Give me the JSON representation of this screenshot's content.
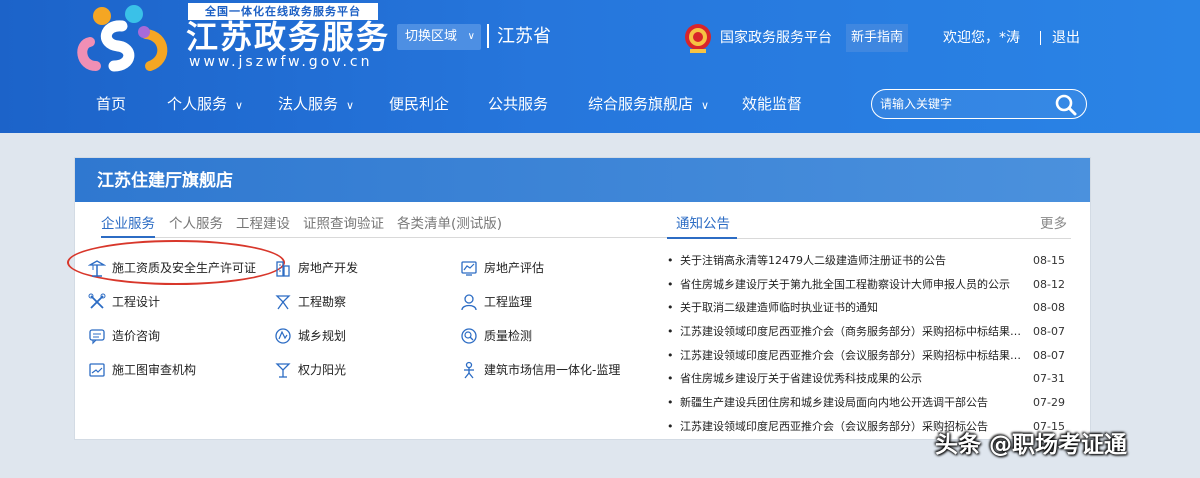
{
  "header": {
    "brand_tag": "全国一体化在线政务服务平台",
    "brand_title": "江苏政务服务",
    "brand_url": "www.jszwfw.gov.cn",
    "switch_region": "切换区域",
    "region_name": "江苏省",
    "gov_platform": "国家政务服务平台",
    "guide": "新手指南",
    "welcome": "欢迎您，*涛",
    "logout": "退出"
  },
  "nav": {
    "items": [
      "首页",
      "个人服务",
      "法人服务",
      "便民利企",
      "公共服务",
      "综合服务旗舰店",
      "效能监督"
    ]
  },
  "search": {
    "placeholder": "请输入关键字"
  },
  "panel": {
    "title": "江苏住建厅旗舰店",
    "tabs": [
      "企业服务",
      "个人服务",
      "工程建设",
      "证照查询验证",
      "各类清单(测试版)"
    ],
    "services": [
      {
        "label": "施工资质及安全生产许可证",
        "icon": "construction-crane-icon"
      },
      {
        "label": "房地产开发",
        "icon": "building-icon"
      },
      {
        "label": "房地产评估",
        "icon": "chart-screen-icon"
      },
      {
        "label": "工程设计",
        "icon": "tools-icon"
      },
      {
        "label": "工程勘察",
        "icon": "survey-icon"
      },
      {
        "label": "工程监理",
        "icon": "supervisor-icon"
      },
      {
        "label": "造价咨询",
        "icon": "chat-icon"
      },
      {
        "label": "城乡规划",
        "icon": "planning-icon"
      },
      {
        "label": "质量检测",
        "icon": "magnifier-icon"
      },
      {
        "label": "施工图审查机构",
        "icon": "blueprint-icon"
      },
      {
        "label": "权力阳光",
        "icon": "power-icon"
      },
      {
        "label": "建筑市场信用一体化-监理",
        "icon": "worker-icon"
      }
    ],
    "notice_tab": "通知公告",
    "notice_more": "更多",
    "notices": [
      {
        "text": "关于注销高永清等12479人二级建造师注册证书的公告",
        "date": "08-15"
      },
      {
        "text": "省住房城乡建设厅关于第九批全国工程勘察设计大师申报人员的公示",
        "date": "08-12"
      },
      {
        "text": "关于取消二级建造师临时执业证书的通知",
        "date": "08-08"
      },
      {
        "text": "江苏建设领域印度尼西亚推介会（商务服务部分）采购招标中标结果公...",
        "date": "08-07"
      },
      {
        "text": "江苏建设领域印度尼西亚推介会（会议服务部分）采购招标中标结果公...",
        "date": "08-07"
      },
      {
        "text": "省住房城乡建设厅关于省建设优秀科技成果的公示",
        "date": "07-31"
      },
      {
        "text": "新疆生产建设兵团住房和城乡建设局面向内地公开选调干部公告",
        "date": "07-29"
      },
      {
        "text": "江苏建设领域印度尼西亚推介会（会议服务部分）采购招标公告",
        "date": "07-15"
      }
    ]
  },
  "watermark": "头条 @职场考证通",
  "colors": {
    "header_blue": "#2676dc",
    "accent": "#2c6cc4",
    "highlight_ring": "#d8372b"
  }
}
